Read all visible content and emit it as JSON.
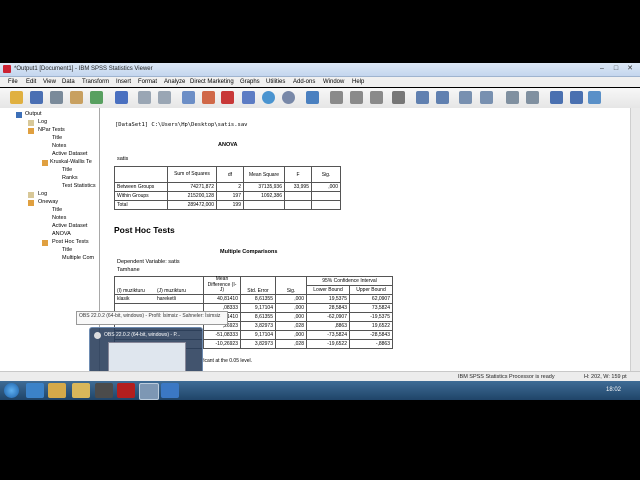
{
  "window": {
    "title": "*Output1 [Document1] - IBM SPSS Statistics Viewer"
  },
  "menu": [
    "File",
    "Edit",
    "View",
    "Data",
    "Transform",
    "Insert",
    "Format",
    "Analyze",
    "Direct Marketing",
    "Graphs",
    "Utilities",
    "Add-ons",
    "Window",
    "Help"
  ],
  "tree": {
    "output": "Output",
    "log1": "Log",
    "npar": "NPar Tests",
    "npar_title": "Title",
    "npar_notes": "Notes",
    "npar_active": "Active Dataset",
    "kw": "Kruskal-Wallis Te",
    "kw_title": "Title",
    "kw_ranks": "Ranks",
    "kw_test": "Test Statistics",
    "log2": "Log",
    "oneway": "Oneway",
    "ow_title": "Title",
    "ow_notes": "Notes",
    "ow_active": "Active Dataset",
    "ow_anova": "ANOVA",
    "posthoc": "Post Hoc Tests",
    "ph_title": "Title",
    "ph_mc": "Multiple Com"
  },
  "content": {
    "dataset_line": "[DataSet1] C:\\Users\\Hp\\Desktop\\satis.sav",
    "anova": {
      "title": "ANOVA",
      "dep": "satis",
      "headers": [
        "",
        "Sum of Squares",
        "df",
        "Mean Square",
        "F",
        "Sig."
      ],
      "rows": [
        [
          "Between Groups",
          "74271,872",
          "2",
          "37135,936",
          "33,995",
          ",000"
        ],
        [
          "Within Groups",
          "215200,128",
          "197",
          "1092,386",
          "",
          ""
        ],
        [
          "Total",
          "289472,000",
          "199",
          "",
          "",
          ""
        ]
      ]
    },
    "posthoc_heading": "Post Hoc Tests",
    "mc": {
      "title": "Multiple Comparisons",
      "dep": "Dependent Variable: satis",
      "method": "Tamhane",
      "h_i": "(I) muzikturu",
      "h_j": "(J) muzikturu",
      "h_md": "Mean Difference (I-J)",
      "h_se": "Std. Error",
      "h_sig": "Sig.",
      "h_ci": "95% Confidence Interval",
      "h_lb": "Lower Bound",
      "h_ub": "Upper Bound",
      "rows": [
        [
          "klasik",
          "hareketli",
          "40,81410",
          "8,61355",
          ",000",
          "19,5375",
          "62,0907"
        ],
        [
          "",
          "",
          ",08333",
          "9,17104",
          ",000",
          "28,5843",
          "73,5824"
        ],
        [
          "",
          "",
          ",81410",
          "8,61355",
          ",000",
          "-62,0907",
          "-19,5375"
        ],
        [
          "",
          "",
          ",26923",
          "3,82973",
          ",028",
          ",8863",
          "19,6522"
        ],
        [
          "",
          "",
          "-51,08333",
          "9,17104",
          ",000",
          "-73,5824",
          "-28,5843"
        ],
        [
          "",
          "",
          "-10,26923",
          "3,82973",
          ",028",
          "-19,6522",
          "-,8863"
        ]
      ],
      "footnote": "ficant at the 0.05 level."
    }
  },
  "tooltip": "OBS 22.0.2 (64-bit, windows) - Profil: İsimsiz - Sahneler: İsimsiz",
  "thumb_label": "OBS 22.0.2 (64-bit, windows) - P...",
  "status": {
    "processor": "IBM SPSS Statistics Processor is ready",
    "size": "H: 202, W: 159 pt"
  },
  "taskbar": {
    "time": "18:02"
  }
}
